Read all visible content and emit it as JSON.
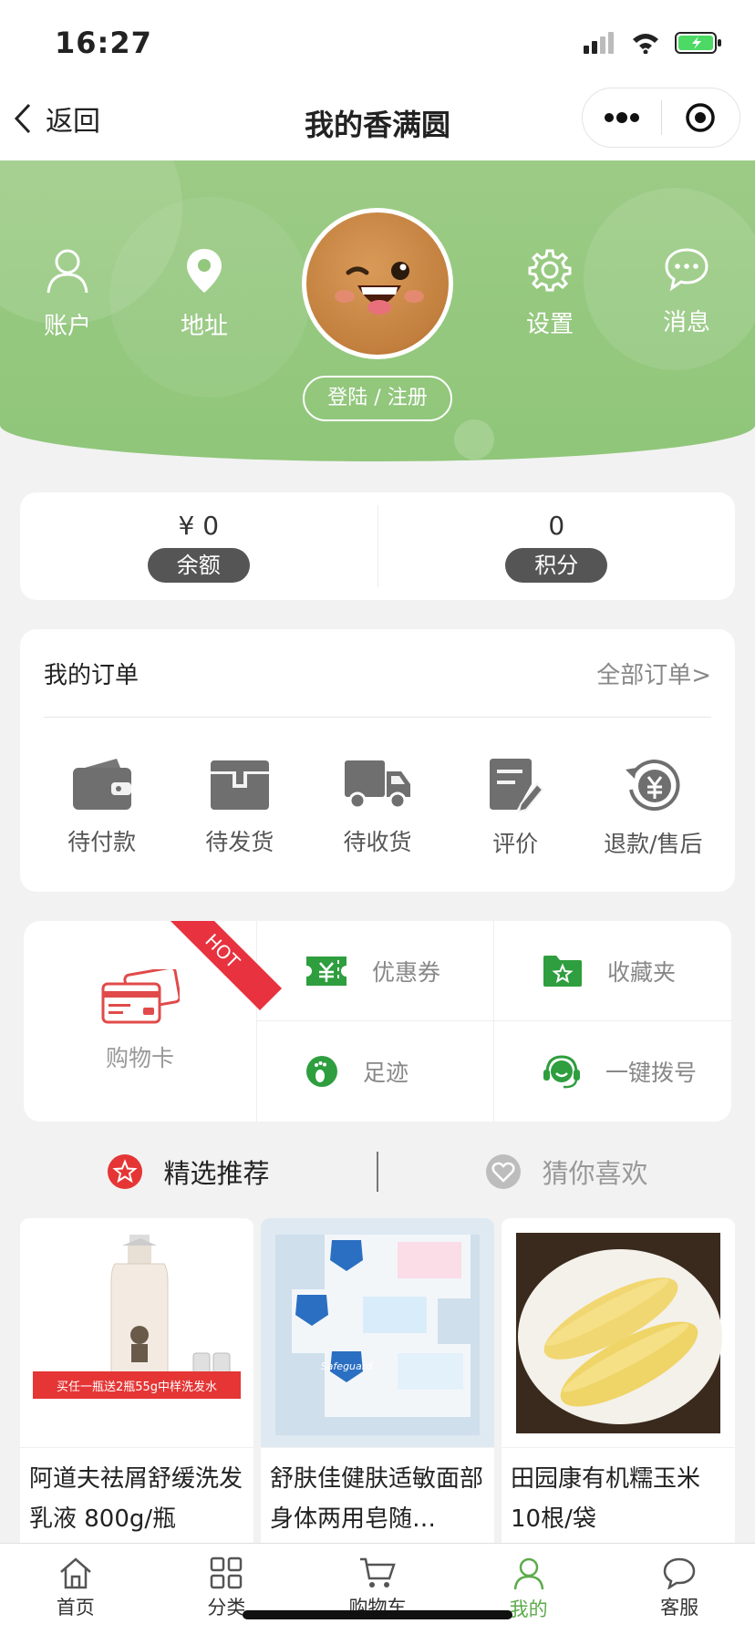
{
  "status_bar": {
    "time": "16:27"
  },
  "nav": {
    "back_label": "返回",
    "title": "我的香满圆"
  },
  "header": {
    "items_left": [
      {
        "label": "账户",
        "icon": "user-icon"
      },
      {
        "label": "地址",
        "icon": "location-pin-icon"
      }
    ],
    "items_right": [
      {
        "label": "设置",
        "icon": "gear-icon"
      },
      {
        "label": "消息",
        "icon": "chat-bubble-icon"
      }
    ],
    "login_label": "登陆 / 注册",
    "bg_color": "#92c77c"
  },
  "balance": {
    "balance_value": "¥ 0",
    "balance_label": "余额",
    "points_value": "0",
    "points_label": "积分"
  },
  "orders": {
    "title": "我的订单",
    "all_link": "全部订单>",
    "items": [
      {
        "label": "待付款",
        "icon": "wallet-icon"
      },
      {
        "label": "待发货",
        "icon": "package-icon"
      },
      {
        "label": "待收货",
        "icon": "truck-icon"
      },
      {
        "label": "评价",
        "icon": "review-icon"
      },
      {
        "label": "退款/售后",
        "icon": "refund-icon"
      }
    ]
  },
  "services": {
    "shopping_card_label": "购物卡",
    "hot_badge": "HOT",
    "cells": [
      {
        "label": "优惠券",
        "icon": "coupon-icon"
      },
      {
        "label": "收藏夹",
        "icon": "favorites-folder-icon"
      },
      {
        "label": "足迹",
        "icon": "footprint-icon"
      },
      {
        "label": "一键拨号",
        "icon": "headset-icon"
      }
    ],
    "accent_green": "#2e9e3e"
  },
  "recommend": {
    "tabs": [
      {
        "label": "精选推荐",
        "icon": "star-badge-icon",
        "active": true
      },
      {
        "label": "猜你喜欢",
        "icon": "heart-badge-icon",
        "active": false
      }
    ]
  },
  "products": [
    {
      "name": "阿道夫祛屑舒缓洗发乳液 800g/瓶",
      "image_banner": "买任一瓶送2瓶55g中样洗发水"
    },
    {
      "name": "舒肤佳健肤适敏面部身体两用皂随…",
      "image_brand": "Safeguard"
    },
    {
      "name": "田园康有机糯玉米10根/袋"
    }
  ],
  "tab_bar": {
    "tabs": [
      {
        "label": "首页",
        "icon": "home-icon",
        "active": false
      },
      {
        "label": "分类",
        "icon": "grid-icon",
        "active": false
      },
      {
        "label": "购物车",
        "icon": "cart-icon",
        "active": false
      },
      {
        "label": "我的",
        "icon": "person-icon",
        "active": true
      },
      {
        "label": "客服",
        "icon": "chat-icon",
        "active": false
      }
    ],
    "active_color": "#5bab4a"
  }
}
